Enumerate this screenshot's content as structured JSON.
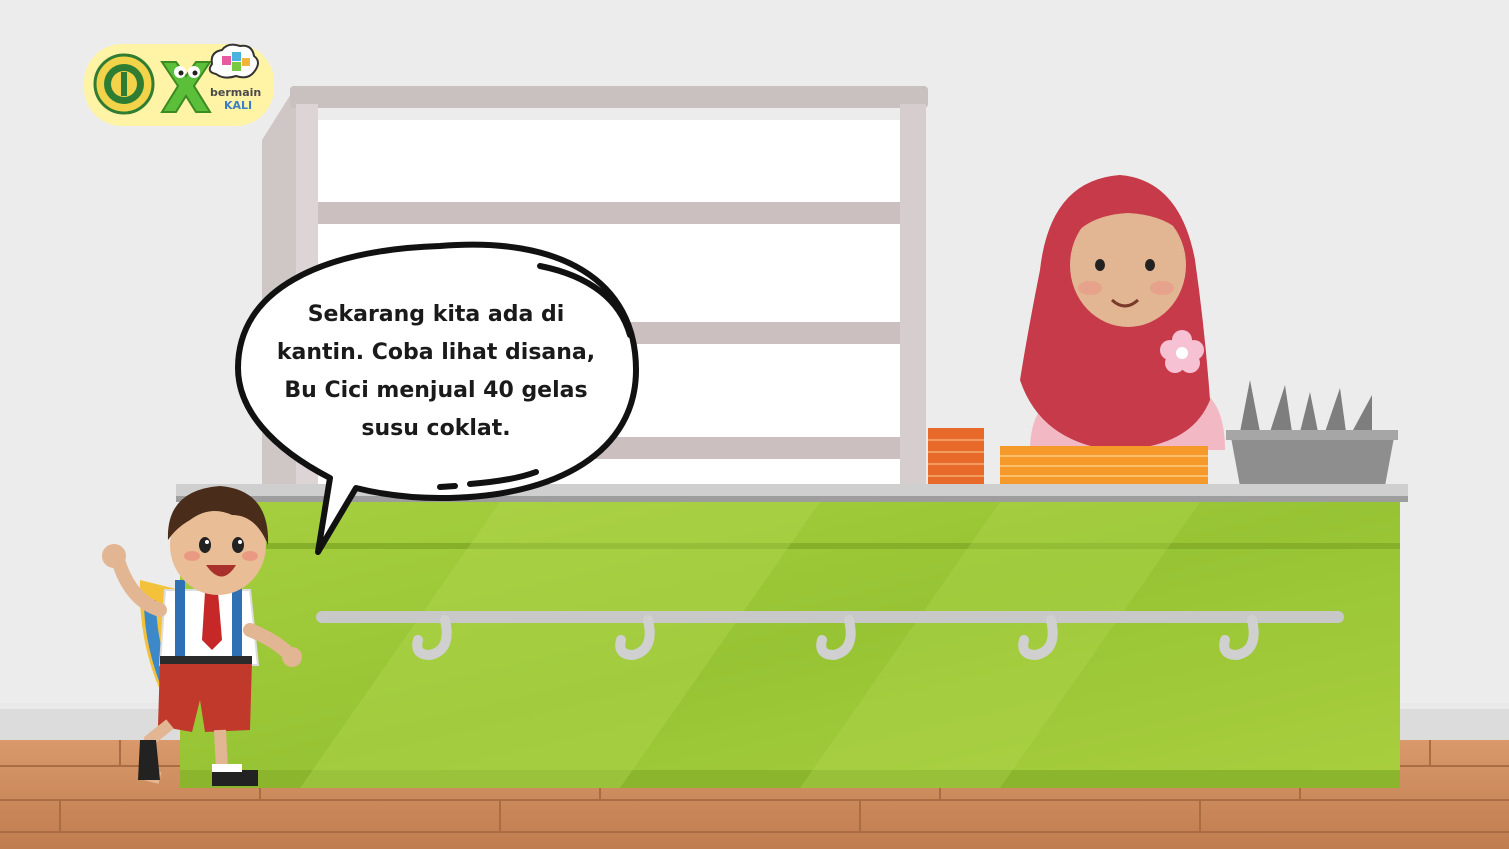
{
  "dialog": {
    "text": "Sekarang kita ada di\nkantin. Coba lihat disana,\nBu Cici menjual 40 gelas\nsusu coklat."
  },
  "logo": {
    "word_top": "bermain",
    "word_bottom": "KALI"
  },
  "colors": {
    "wall": "#ededed",
    "floor": "#c98a5a",
    "counter": "#9cc63a",
    "hijab": "#c93a4a",
    "badge": "#fff3a6"
  },
  "icons": {
    "university_logo": "seal-icon",
    "mascot": "green-x-mascot-icon",
    "thought_cloud": "cloud-blocks-icon",
    "flower": "flower-icon"
  }
}
